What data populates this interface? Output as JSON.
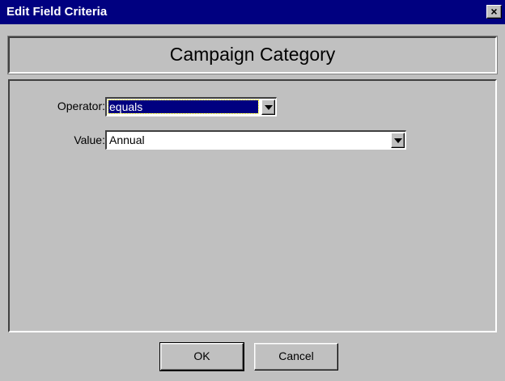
{
  "window": {
    "title": "Edit Field Criteria",
    "close_label": "×"
  },
  "header": {
    "heading": "Campaign Category"
  },
  "form": {
    "operator": {
      "label": "Operator:",
      "value": "equals"
    },
    "value_field": {
      "label": "Value:",
      "value": "Annual"
    }
  },
  "buttons": {
    "ok_label": "OK",
    "cancel_label": "Cancel"
  },
  "colors": {
    "titlebar": "#000080",
    "face": "#c0c0c0",
    "selection": "#000080"
  }
}
